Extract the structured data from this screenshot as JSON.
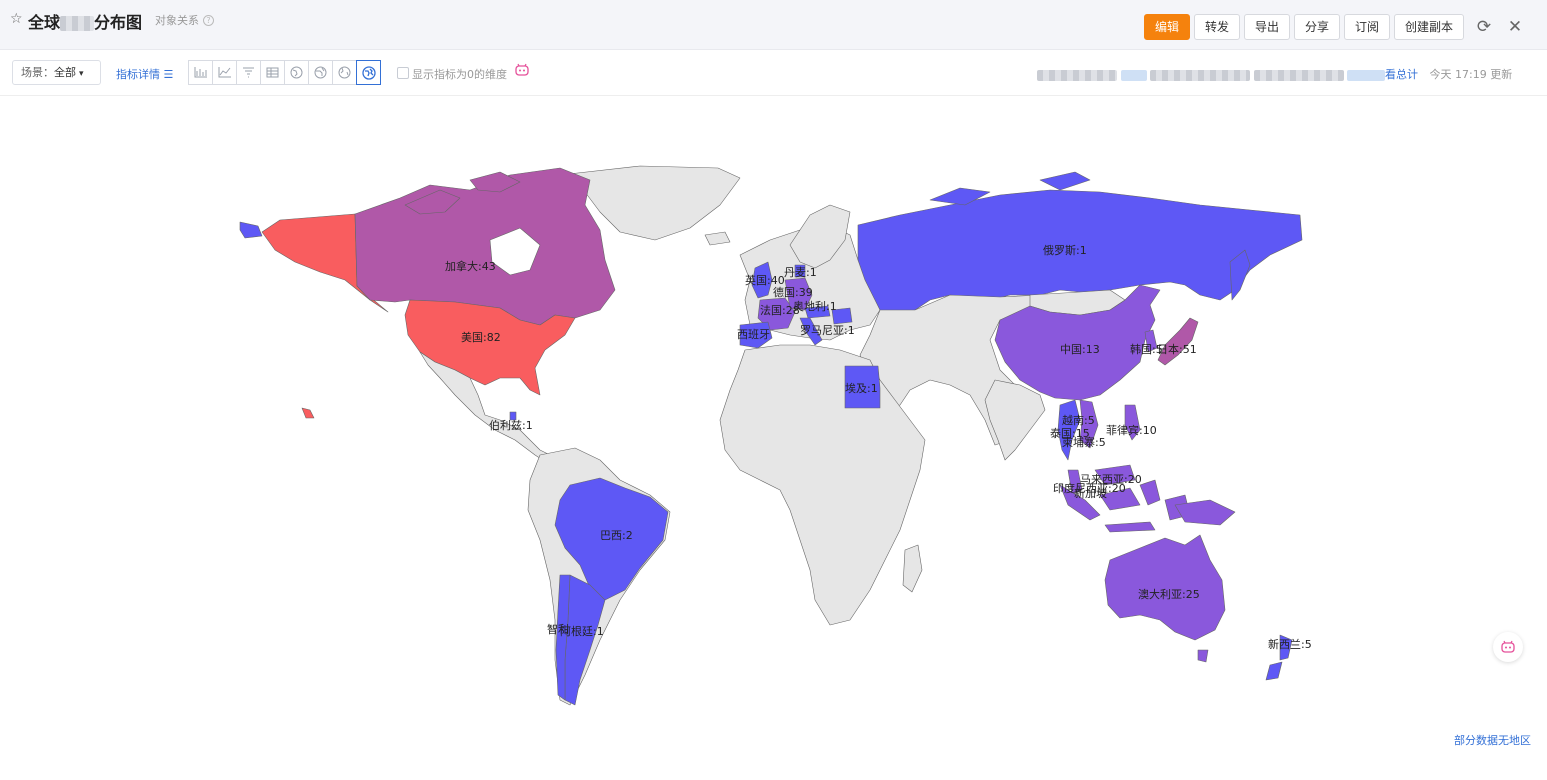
{
  "header": {
    "title_prefix": "全球",
    "title_suffix": "分布图",
    "subtitle": "对象关系",
    "help_icon": "?",
    "buttons": {
      "edit": "编辑",
      "forward": "转发",
      "export": "导出",
      "share": "分享",
      "subscribe": "订阅",
      "duplicate": "创建副本"
    }
  },
  "toolbar": {
    "scene_label": "场景：",
    "scene_value": "全部",
    "metric_detail": "指标详情",
    "show_zero_label": "显示指标为0的维度",
    "view_total": "看总计",
    "updated": "今天 17:19 更新"
  },
  "colors": {
    "high": "#f95d5f",
    "mid": "#b058a8",
    "low": "#5e58f5",
    "midlow": "#8a58dc",
    "none": "#e6e6e6",
    "accent": "#f5820d",
    "link": "#3370d6"
  },
  "map": {
    "labels": [
      {
        "name": "加拿大",
        "value": 43
      },
      {
        "name": "美国",
        "value": 82
      },
      {
        "name": "俄罗斯",
        "value": 1
      },
      {
        "name": "中国",
        "value": 13
      },
      {
        "name": "韩国",
        "value": 5
      },
      {
        "name": "日本",
        "value": 51
      },
      {
        "name": "英国",
        "value": 40
      },
      {
        "name": "丹麦",
        "value": 1
      },
      {
        "name": "德国",
        "value": 39
      },
      {
        "name": "法国",
        "value": 28
      },
      {
        "name": "奥地利",
        "value": 1
      },
      {
        "name": "西班牙",
        "value": null
      },
      {
        "name": "罗马尼亚",
        "value": 1
      },
      {
        "name": "埃及",
        "value": 1
      },
      {
        "name": "伯利兹",
        "value": 1
      },
      {
        "name": "巴西",
        "value": 2
      },
      {
        "name": "智利",
        "value": null
      },
      {
        "name": "阿根廷",
        "value": 1
      },
      {
        "name": "菲律宾",
        "value": 10
      },
      {
        "name": "泰国",
        "value": 15
      },
      {
        "name": "越南",
        "value": 5
      },
      {
        "name": "柬埔寨",
        "value": 5
      },
      {
        "name": "马来西亚",
        "value": 20
      },
      {
        "name": "印度尼西亚",
        "value": 20
      },
      {
        "name": "新加坡",
        "value": null
      },
      {
        "name": "澳大利亚",
        "value": 25
      },
      {
        "name": "新西兰",
        "value": 5
      }
    ],
    "no_data_text": "部分数据无地区"
  }
}
